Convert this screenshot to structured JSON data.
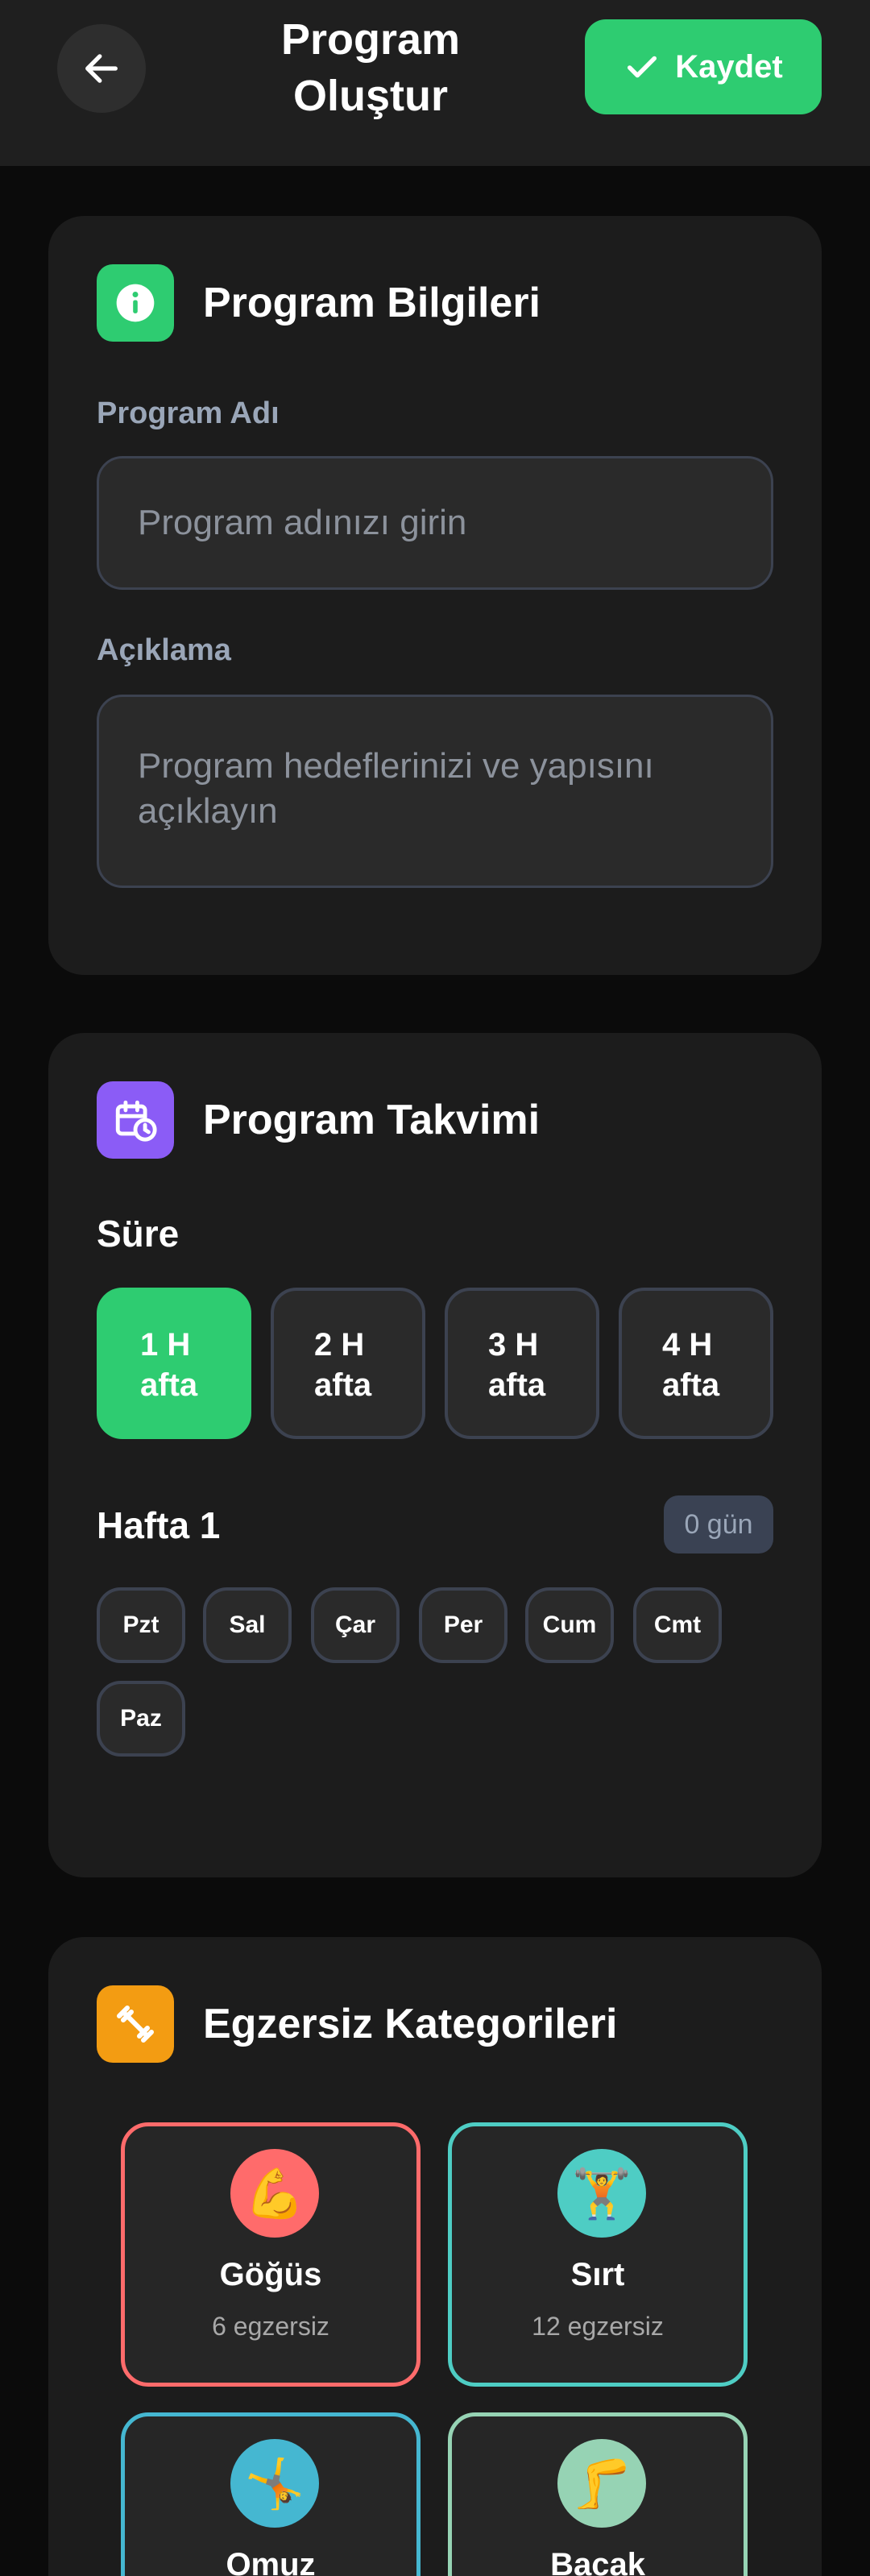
{
  "header": {
    "title_line1": "Program",
    "title_line2": "Oluştur",
    "save_label": "Kaydet",
    "back_icon": "arrow-left-icon",
    "save_icon": "check-icon"
  },
  "info_card": {
    "title": "Program Bilgileri",
    "icon": "info-icon",
    "icon_color": "#2ecc71",
    "name_label": "Program Adı",
    "name_placeholder": "Program adınızı girin",
    "name_value": "",
    "desc_label": "Açıklama",
    "desc_placeholder": "Program hedeflerinizi ve yapısını açıklayın",
    "desc_value": ""
  },
  "schedule_card": {
    "title": "Program Takvimi",
    "icon": "calendar-clock-icon",
    "icon_color": "#8b5cf6",
    "duration_label": "Süre",
    "durations": [
      {
        "line1": "1 H",
        "line2": "afta",
        "selected": true
      },
      {
        "line1": "2 H",
        "line2": "afta",
        "selected": false
      },
      {
        "line1": "3 H",
        "line2": "afta",
        "selected": false
      },
      {
        "line1": "4 H",
        "line2": "afta",
        "selected": false
      }
    ],
    "week_label": "Hafta 1",
    "day_count": "0 gün",
    "days": [
      "Pzt",
      "Sal",
      "Çar",
      "Per",
      "Cum",
      "Cmt",
      "Paz"
    ]
  },
  "categories_card": {
    "title": "Egzersiz Kategorileri",
    "icon": "dumbbell-icon",
    "icon_color": "#f39c12",
    "items": [
      {
        "name": "Göğüs",
        "count": "6 egzersiz",
        "emoji": "💪",
        "color": "#ff6b6b"
      },
      {
        "name": "Sırt",
        "count": "12 egzersiz",
        "emoji": "🏋",
        "color": "#4ecdc4"
      },
      {
        "name": "Omuz",
        "count": "",
        "emoji": "🤸",
        "color": "#45b7d1"
      },
      {
        "name": "Bacak",
        "count": "",
        "emoji": "🦵",
        "color": "#96d3b4"
      }
    ]
  },
  "colors": {
    "accent": "#2ecc71",
    "background": "#0b0b0b",
    "card": "#1c1c1c"
  }
}
